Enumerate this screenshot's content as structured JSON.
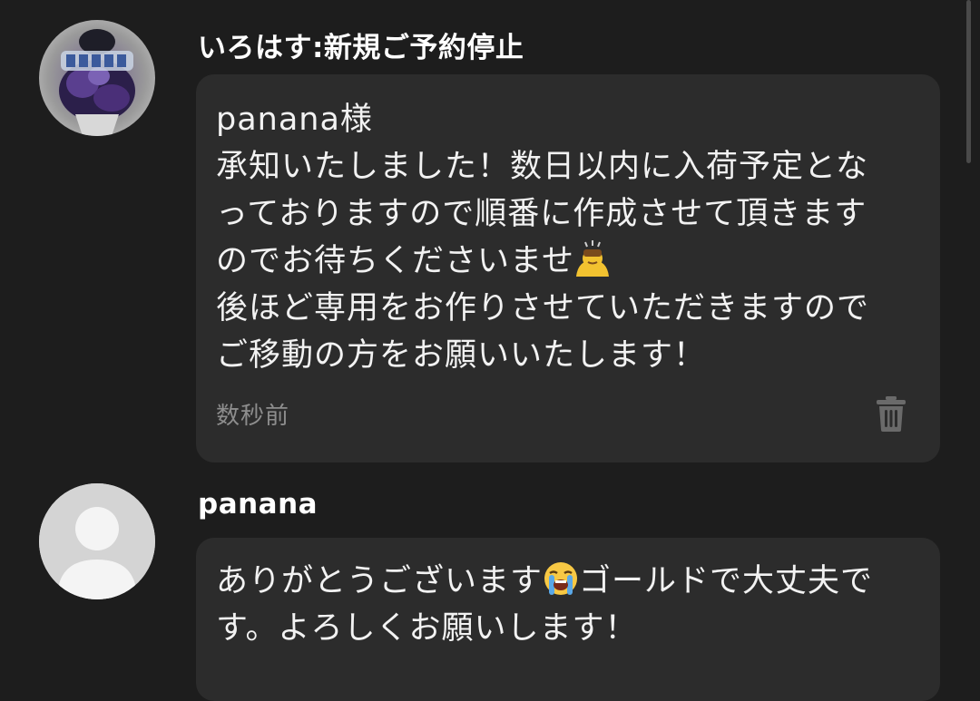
{
  "colors": {
    "background": "#1d1d1d",
    "bubble": "#2c2c2c",
    "text": "#f2f2f2",
    "muted": "#8d8d8d"
  },
  "messages": [
    {
      "username": "いろはす:新規ご予約停止",
      "lines": [
        "panana様",
        "承知いたしました！数日以内に入荷予定とな",
        "っておりますので順番に作成させて頂きます",
        "のでお待ちくださいませ",
        "後ほど専用をお作りさせていただきますので",
        "ご移動の方をお願いいたします！"
      ],
      "emoji": "person-bowing-emoji",
      "timestamp": "数秒前",
      "delete_icon": "trash-icon",
      "avatar_icon": "bouquet-photo-avatar"
    },
    {
      "username": "panana",
      "line1_a": "ありがとうございます",
      "line1_b": "ゴールドで大丈夫で",
      "line2": "す。よろしくお願いします！",
      "emoji": "loudly-crying-face-emoji",
      "avatar_icon": "default-user-avatar"
    }
  ]
}
